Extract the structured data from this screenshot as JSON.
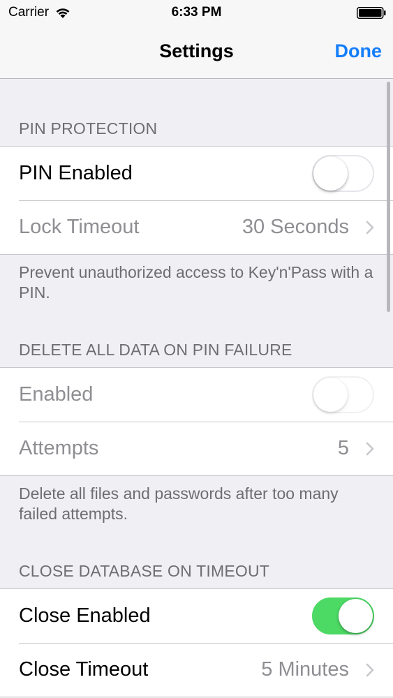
{
  "status_bar": {
    "carrier": "Carrier",
    "time": "6:33 PM",
    "wifi_icon": "wifi-icon",
    "battery_icon": "battery-full-icon"
  },
  "nav": {
    "title": "Settings",
    "done_label": "Done",
    "accent_color": "#147efb"
  },
  "sections": {
    "pin": {
      "header": "PIN PROTECTION",
      "pin_enabled_label": "PIN Enabled",
      "pin_enabled_on": false,
      "lock_timeout_label": "Lock Timeout",
      "lock_timeout_value": "30 Seconds",
      "footer": "Prevent unauthorized access to Key'n'Pass with a PIN."
    },
    "delete": {
      "header": "DELETE ALL DATA ON PIN FAILURE",
      "enabled_label": "Enabled",
      "enabled_on": false,
      "attempts_label": "Attempts",
      "attempts_value": "5",
      "footer": "Delete all files and passwords after too many failed attempts."
    },
    "close_db": {
      "header": "CLOSE DATABASE ON TIMEOUT",
      "close_enabled_label": "Close Enabled",
      "close_enabled_on": true,
      "close_timeout_label": "Close Timeout",
      "close_timeout_value": "5 Minutes"
    }
  },
  "colors": {
    "toggle_on": "#4cd964",
    "background": "#efeff4"
  }
}
